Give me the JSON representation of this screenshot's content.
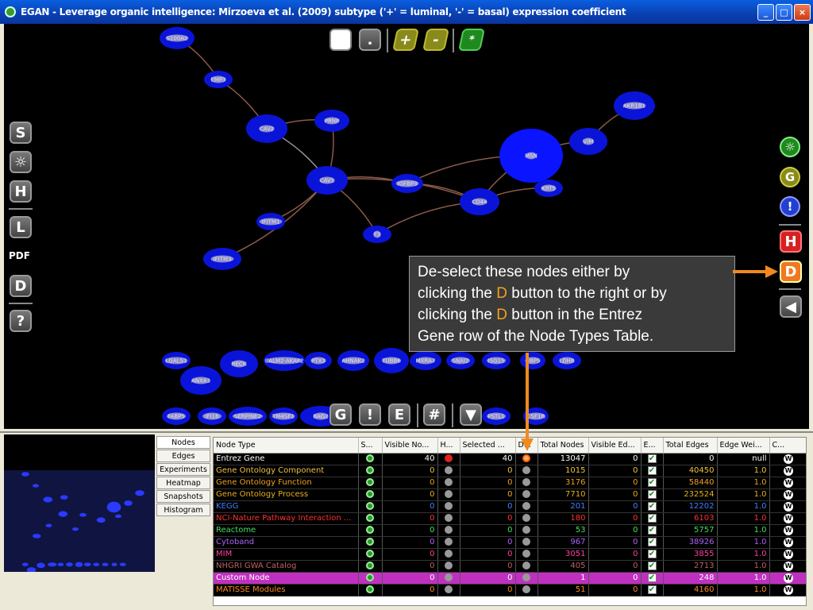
{
  "window": {
    "title": "EGAN - Leverage organic intelligence: Mirzoeva et al. (2009) subtype ('+' = luminal, '-' = basal) expression coefficient",
    "min": "_",
    "max": "□",
    "close": "×"
  },
  "toolbar_top": {
    "white": "",
    "dot": ".",
    "plus": "+",
    "minus": "-",
    "star": "*"
  },
  "toolbar_left": {
    "s": "S",
    "gear": "☼",
    "h": "H",
    "l": "L",
    "pdf": "PDF",
    "d": "D",
    "help": "?"
  },
  "toolbar_right": {
    "gear": "☼",
    "g": "G",
    "excl": "!",
    "h": "H",
    "d": "D",
    "back": "◀"
  },
  "toolbar_bottom": {
    "g": "G",
    "excl": "!",
    "e": "E",
    "hash": "#",
    "down": "▼"
  },
  "callout": {
    "line1": "De-select these nodes either by",
    "l2a": "clicking the ",
    "l2b": "D",
    "l2c": " button to the right or by",
    "l3a": "clicking the ",
    "l3b": "D",
    "l3c": " button in the Entrez",
    "line4": "Gene row of the Node Types Table."
  },
  "network": {
    "nodes": [
      {
        "label": "S100A2"
      },
      {
        "label": "EMP3"
      },
      {
        "label": "CAV2"
      },
      {
        "label": "PRNP"
      },
      {
        "label": "AKR1B1"
      },
      {
        "label": "VIM"
      },
      {
        "label": "MSN"
      },
      {
        "label": "CAV1"
      },
      {
        "label": "IGFBP3"
      },
      {
        "label": "CD44"
      },
      {
        "label": "KRT5"
      },
      {
        "label": "IFITM1"
      },
      {
        "label": "F3"
      },
      {
        "label": "IFITM3"
      },
      {
        "label": "LGALS1"
      },
      {
        "label": "RECK"
      },
      {
        "label": "CALM2-AKAP2"
      },
      {
        "label": "PTX3"
      },
      {
        "label": "AHNAK2"
      },
      {
        "label": "TUBB6"
      },
      {
        "label": "MXRA7"
      },
      {
        "label": "SNAI2"
      },
      {
        "label": "ISG15"
      },
      {
        "label": "GBP5"
      },
      {
        "label": "LDHB"
      },
      {
        "label": "ANXA1"
      },
      {
        "label": "FABP5"
      },
      {
        "label": "IFI16"
      },
      {
        "label": "SERPINE2"
      },
      {
        "label": "TM4SF1"
      },
      {
        "label": "BAG2"
      },
      {
        "label": "PSTL1"
      },
      {
        "label": "CSF1R"
      }
    ]
  },
  "side_tabs": [
    "Nodes",
    "Edges",
    "Experiments",
    "Heatmap",
    "Snapshots",
    "Histogram"
  ],
  "table": {
    "headers": [
      "Node Type",
      "S...",
      "Visible No...",
      "H...",
      "Selected ...",
      "D...",
      "Total Nodes",
      "Visible Ed...",
      "E...",
      "Total Edges",
      "Edge Wei...",
      "C..."
    ],
    "rows": [
      {
        "name": "Entrez Gene",
        "color": "#ffffff",
        "visible": "40",
        "selected": "40",
        "total": "13047",
        "vedges": "0",
        "tedges": "0",
        "weight": "null",
        "hmark": "H",
        "dmark": "sel"
      },
      {
        "name": "Gene Ontology Component",
        "color": "#f0c040",
        "visible": "0",
        "selected": "0",
        "total": "1015",
        "vedges": "0",
        "tedges": "40450",
        "weight": "1.0"
      },
      {
        "name": "Gene Ontology Function",
        "color": "#f0a020",
        "visible": "0",
        "selected": "0",
        "total": "3176",
        "vedges": "0",
        "tedges": "58440",
        "weight": "1.0"
      },
      {
        "name": "Gene Ontology Process",
        "color": "#e8b020",
        "visible": "0",
        "selected": "0",
        "total": "7710",
        "vedges": "0",
        "tedges": "232524",
        "weight": "1.0"
      },
      {
        "name": "KEGG",
        "color": "#4080ff",
        "visible": "0",
        "selected": "0",
        "total": "201",
        "vedges": "0",
        "tedges": "12202",
        "weight": "1.0"
      },
      {
        "name": "NCI-Nature Pathway Interaction ...",
        "color": "#ff3030",
        "visible": "0",
        "selected": "0",
        "total": "180",
        "vedges": "0",
        "tedges": "6103",
        "weight": "1.0"
      },
      {
        "name": "Reactome",
        "color": "#40e060",
        "visible": "0",
        "selected": "0",
        "total": "53",
        "vedges": "0",
        "tedges": "5757",
        "weight": "1.0"
      },
      {
        "name": "Cytoband",
        "color": "#b060ff",
        "visible": "0",
        "selected": "0",
        "total": "967",
        "vedges": "0",
        "tedges": "38926",
        "weight": "1.0"
      },
      {
        "name": "MIM",
        "color": "#ff40a0",
        "visible": "0",
        "selected": "0",
        "total": "3051",
        "vedges": "0",
        "tedges": "3855",
        "weight": "1.0"
      },
      {
        "name": "NHGRI GWA Catalog",
        "color": "#c06060",
        "visible": "0",
        "selected": "0",
        "total": "405",
        "vedges": "0",
        "tedges": "2713",
        "weight": "1.0"
      },
      {
        "name": "Custom Node",
        "color": "#ffffff",
        "visible": "0",
        "selected": "0",
        "total": "1",
        "vedges": "0",
        "tedges": "248",
        "weight": "1.0",
        "custom": true
      },
      {
        "name": "MATISSE Modules",
        "color": "#ff8c20",
        "visible": "0",
        "selected": "0",
        "total": "51",
        "vedges": "0",
        "tedges": "4160",
        "weight": "1.0"
      }
    ],
    "icons": {
      "green": "circle-green-icon",
      "grey": "circle-grey-icon",
      "check": "✔",
      "w": "W"
    }
  }
}
